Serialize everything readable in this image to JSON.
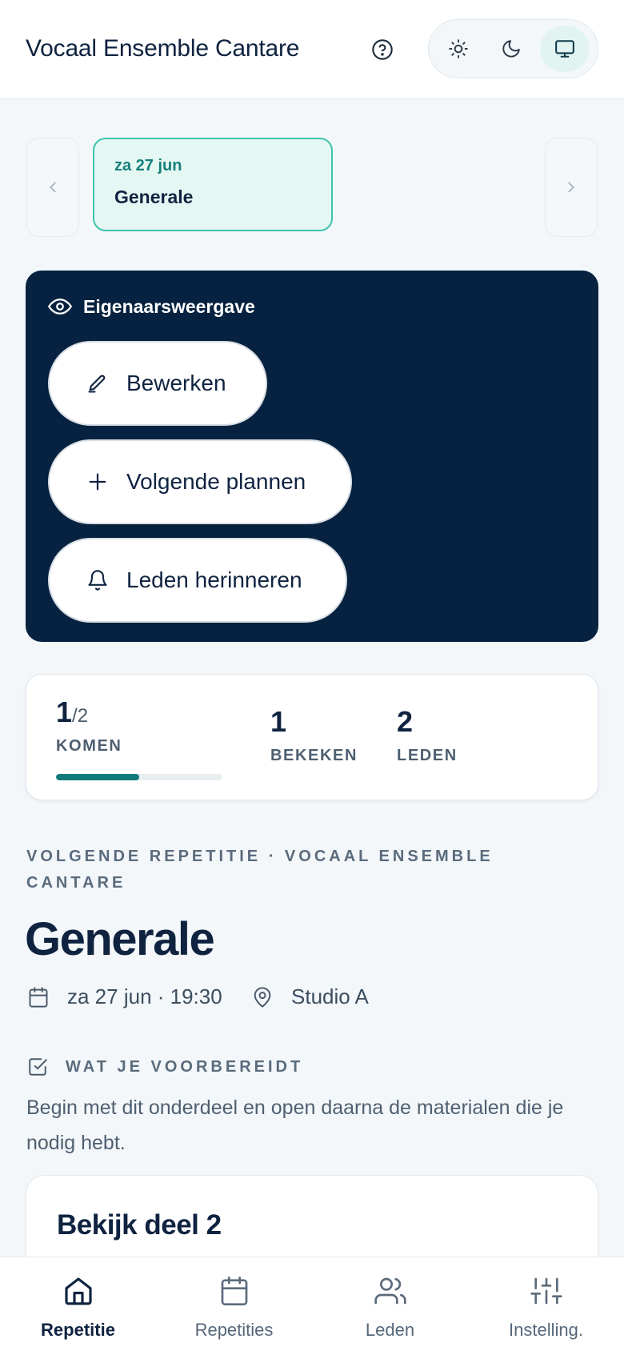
{
  "header": {
    "title": "Vocaal Ensemble Cantare",
    "help_icon": "help-circle-icon",
    "theme_options": [
      {
        "name": "light",
        "icon": "sun-icon",
        "active": false
      },
      {
        "name": "dark",
        "icon": "moon-icon",
        "active": false
      },
      {
        "name": "system",
        "icon": "monitor-icon",
        "active": true
      }
    ]
  },
  "date_strip": {
    "selected": {
      "date": "za 27 jun",
      "title": "Generale"
    }
  },
  "owner_panel": {
    "title": "Eigenaarsweergave",
    "actions": [
      {
        "label": "Bewerken",
        "icon": "pencil-icon"
      },
      {
        "label": "Volgende plannen",
        "icon": "plus-icon"
      },
      {
        "label": "Leden herinneren",
        "icon": "bell-icon"
      }
    ]
  },
  "stats": {
    "attending": {
      "value": "1",
      "total": "/2",
      "label": "KOMEN",
      "progress_fraction": 0.5
    },
    "viewed": {
      "value": "1",
      "label": "BEKEKEN"
    },
    "members": {
      "value": "2",
      "label": "LEDEN"
    }
  },
  "event": {
    "eyebrow": "VOLGENDE REPETITIE · VOCAAL ENSEMBLE CANTARE",
    "title": "Generale",
    "datetime": "za 27 jun · 19:30",
    "location": "Studio A"
  },
  "preparation": {
    "title": "WAT JE VOORBEREIDT",
    "description": "Begin met dit onderdeel en open daarna de materialen die je nodig hebt.",
    "part_title": "Bekijk deel 2"
  },
  "bottom_nav": {
    "items": [
      {
        "label": "Repetitie",
        "icon": "home-icon",
        "active": true
      },
      {
        "label": "Repetities",
        "icon": "calendar-icon",
        "active": false
      },
      {
        "label": "Leden",
        "icon": "users-icon",
        "active": false
      },
      {
        "label": "Instelling.",
        "icon": "sliders-icon",
        "active": false
      }
    ]
  },
  "colors": {
    "accent_teal": "#17807c",
    "panel_navy": "#062240",
    "chip_border": "#3cc4ad",
    "chip_bg": "#e5f7f3",
    "text_primary": "#0f2340"
  }
}
